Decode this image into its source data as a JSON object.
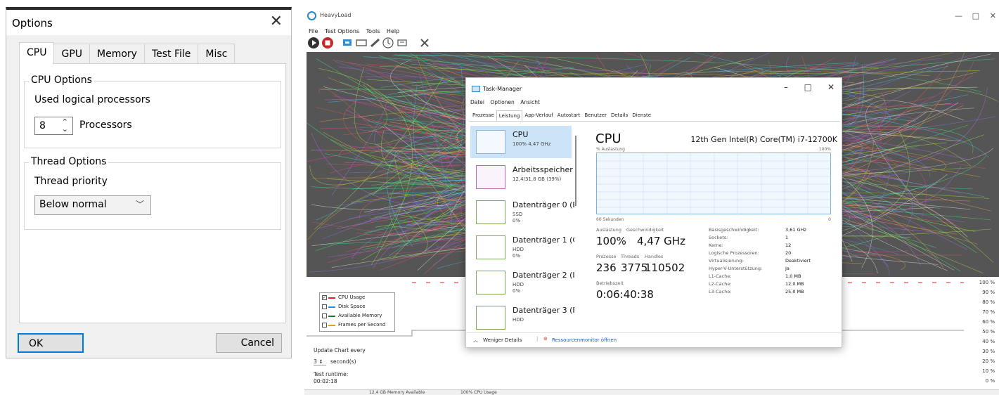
{
  "options_dialog": {
    "title": "Options",
    "close_glyph": "✕",
    "tabs": [
      {
        "label": "CPU",
        "active": true
      },
      {
        "label": "GPU",
        "active": false
      },
      {
        "label": "Memory",
        "active": false
      },
      {
        "label": "Test File",
        "active": false
      },
      {
        "label": "Misc",
        "active": false
      }
    ],
    "cpu_options": {
      "legend": "CPU Options",
      "used_label": "Used logical processors",
      "processors_value": "8",
      "processors_unit": "Processors"
    },
    "thread_options": {
      "legend": "Thread Options",
      "priority_label": "Thread priority",
      "priority_value": "Below normal"
    },
    "ok_label": "OK",
    "cancel_label": "Cancel"
  },
  "heavyload": {
    "title": "HeavyLoad",
    "menu": [
      "File",
      "Test Options",
      "Tools",
      "Help"
    ],
    "toolbar_icons": [
      "play-icon",
      "stop-icon",
      "cpu-icon",
      "drive-icon",
      "memory-icon",
      "clock-icon",
      "gpu-icon",
      "settings-icon"
    ],
    "legend": [
      {
        "label": "CPU Usage",
        "checked": true,
        "color": "#d9262b"
      },
      {
        "label": "Disk Space",
        "checked": false,
        "color": "#2b8fd9"
      },
      {
        "label": "Available Memory",
        "checked": false,
        "color": "#1a7a2e"
      },
      {
        "label": "Frames per Second",
        "checked": false,
        "color": "#e0a020"
      }
    ],
    "update_label": "Update Chart every",
    "update_value": "3",
    "update_unit": "second(s)",
    "runtime_label": "Test runtime:",
    "runtime_value": "00:02:18",
    "y_ticks": [
      "100 %",
      "90 %",
      "80 %",
      "70 %",
      "60 %",
      "50 %",
      "40 %",
      "30 %",
      "20 %",
      "10 %",
      "0 %"
    ],
    "status_items": [
      "12,4 GB Memory Available",
      "100% CPU Usage"
    ],
    "cpu_usage_percent": 100
  },
  "task_manager": {
    "title": "Task-Manager",
    "menu": [
      "Datei",
      "Optionen",
      "Ansicht"
    ],
    "tabs": [
      "Prozesse",
      "Leistung",
      "App-Verlauf",
      "Autostart",
      "Benutzer",
      "Details",
      "Dienste"
    ],
    "active_tab": "Leistung",
    "sidebar": [
      {
        "name": "CPU",
        "line1": "100% 4,47 GHz",
        "line2": "",
        "selected": true
      },
      {
        "name": "Arbeitsspeicher",
        "line1": "12,4/31,8 GB (39%)",
        "line2": "",
        "selected": false
      },
      {
        "name": "Datenträger 0 (E",
        "line1": "SSD",
        "line2": "0%",
        "selected": false
      },
      {
        "name": "Datenträger 1 (C",
        "line1": "HDD",
        "line2": "0%",
        "selected": false
      },
      {
        "name": "Datenträger 2 (I",
        "line1": "HDD",
        "line2": "0%",
        "selected": false
      },
      {
        "name": "Datenträger 3 (F",
        "line1": "HDD",
        "line2": "",
        "selected": false
      }
    ],
    "cpu_heading": "CPU",
    "cpu_name": "12th Gen Intel(R) Core(TM) i7-12700K",
    "graph_label": "% Auslastung",
    "graph_max": "100%",
    "graph_time": "60 Sekunden",
    "graph_min": "0",
    "stats": {
      "auslastung_label": "Auslastung",
      "auslastung_value": "100%",
      "speed_label": "Geschwindigkeit",
      "speed_value": "4,47 GHz",
      "prozesse_label": "Prozesse",
      "prozesse_value": "236",
      "threads_label": "Threads",
      "threads_value": "3775",
      "handles_label": "Handles",
      "handles_value": "110502",
      "uptime_label": "Betriebszeit",
      "uptime_value": "0:06:40:38"
    },
    "details": [
      {
        "key": "Basisgeschwindigkeit:",
        "value": "3,61 GHz"
      },
      {
        "key": "Sockets:",
        "value": "1"
      },
      {
        "key": "Kerne:",
        "value": "12"
      },
      {
        "key": "Logische Prozessoren:",
        "value": "20"
      },
      {
        "key": "Virtualisierung:",
        "value": "Deaktiviert"
      },
      {
        "key": "Hyper-V-Unterstützung:",
        "value": "Ja"
      },
      {
        "key": "L1-Cache:",
        "value": "1,0 MB"
      },
      {
        "key": "L2-Cache:",
        "value": "12,0 MB"
      },
      {
        "key": "L3-Cache:",
        "value": "25,0 MB"
      }
    ],
    "footer_less": "Weniger Details",
    "footer_monitor": "Ressourcenmonitor öffnen"
  }
}
